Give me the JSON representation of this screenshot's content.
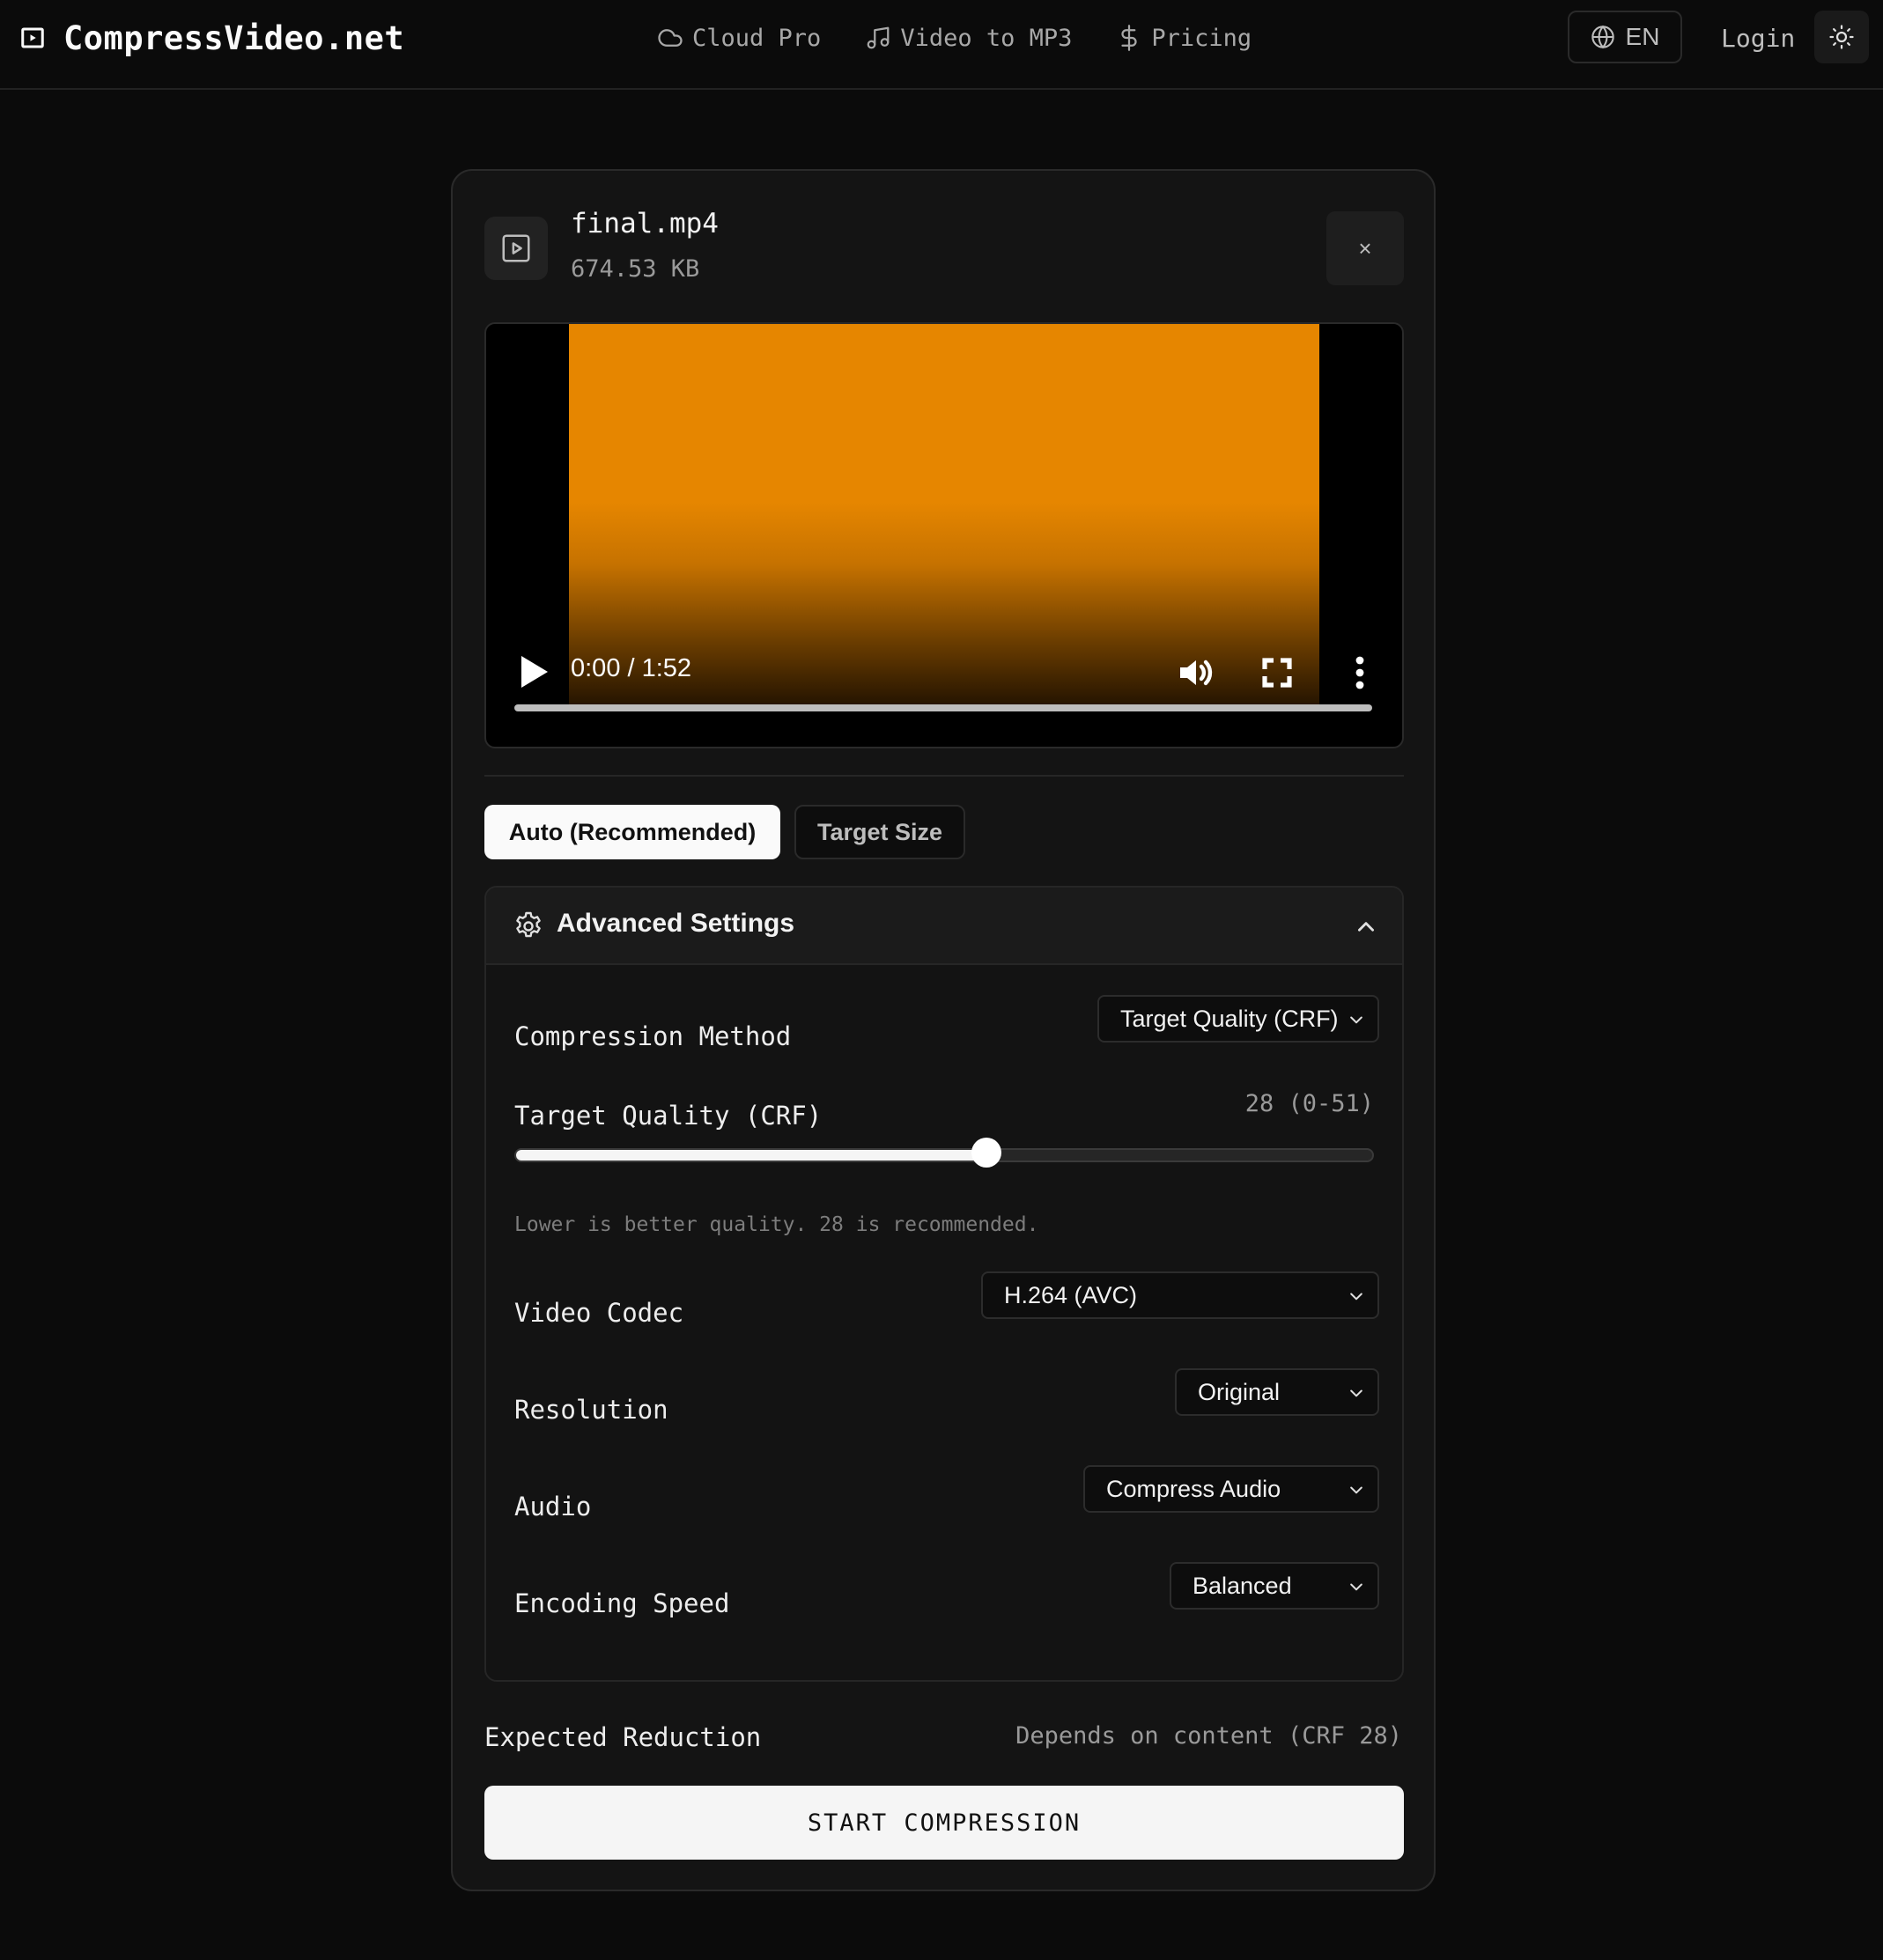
{
  "brand": {
    "name": "CompressVideo.net"
  },
  "nav": {
    "items": [
      {
        "label": "Cloud Pro",
        "icon": "cloud-icon"
      },
      {
        "label": "Video to MP3",
        "icon": "music-note-icon"
      },
      {
        "label": "Pricing",
        "icon": "dollar-icon"
      }
    ],
    "language": "EN",
    "login": "Login"
  },
  "file": {
    "name": "final.mp4",
    "size": "674.53 KB"
  },
  "close_label": "×",
  "player": {
    "time": "0:00 / 1:52",
    "frame_color": "#e68600",
    "progress": 0
  },
  "tabs": [
    {
      "label": "Auto (Recommended)",
      "active": true
    },
    {
      "label": "Target Size",
      "active": false
    }
  ],
  "advanced": {
    "title": "Advanced Settings",
    "expanded": true,
    "compression_method": {
      "label": "Compression Method",
      "value": "Target Quality (CRF)"
    },
    "crf": {
      "label": "Target Quality (CRF)",
      "value": 28,
      "min": 0,
      "max": 51,
      "display": "28 (0-51)",
      "hint": "Lower is better quality. 28 is recommended."
    },
    "video_codec": {
      "label": "Video Codec",
      "value": "H.264 (AVC)"
    },
    "resolution": {
      "label": "Resolution",
      "value": "Original"
    },
    "audio": {
      "label": "Audio",
      "value": "Compress Audio"
    },
    "encoding_speed": {
      "label": "Encoding Speed",
      "value": "Balanced"
    }
  },
  "expected": {
    "label": "Expected Reduction",
    "value": "Depends on content (CRF 28)"
  },
  "start_button": "START COMPRESSION"
}
